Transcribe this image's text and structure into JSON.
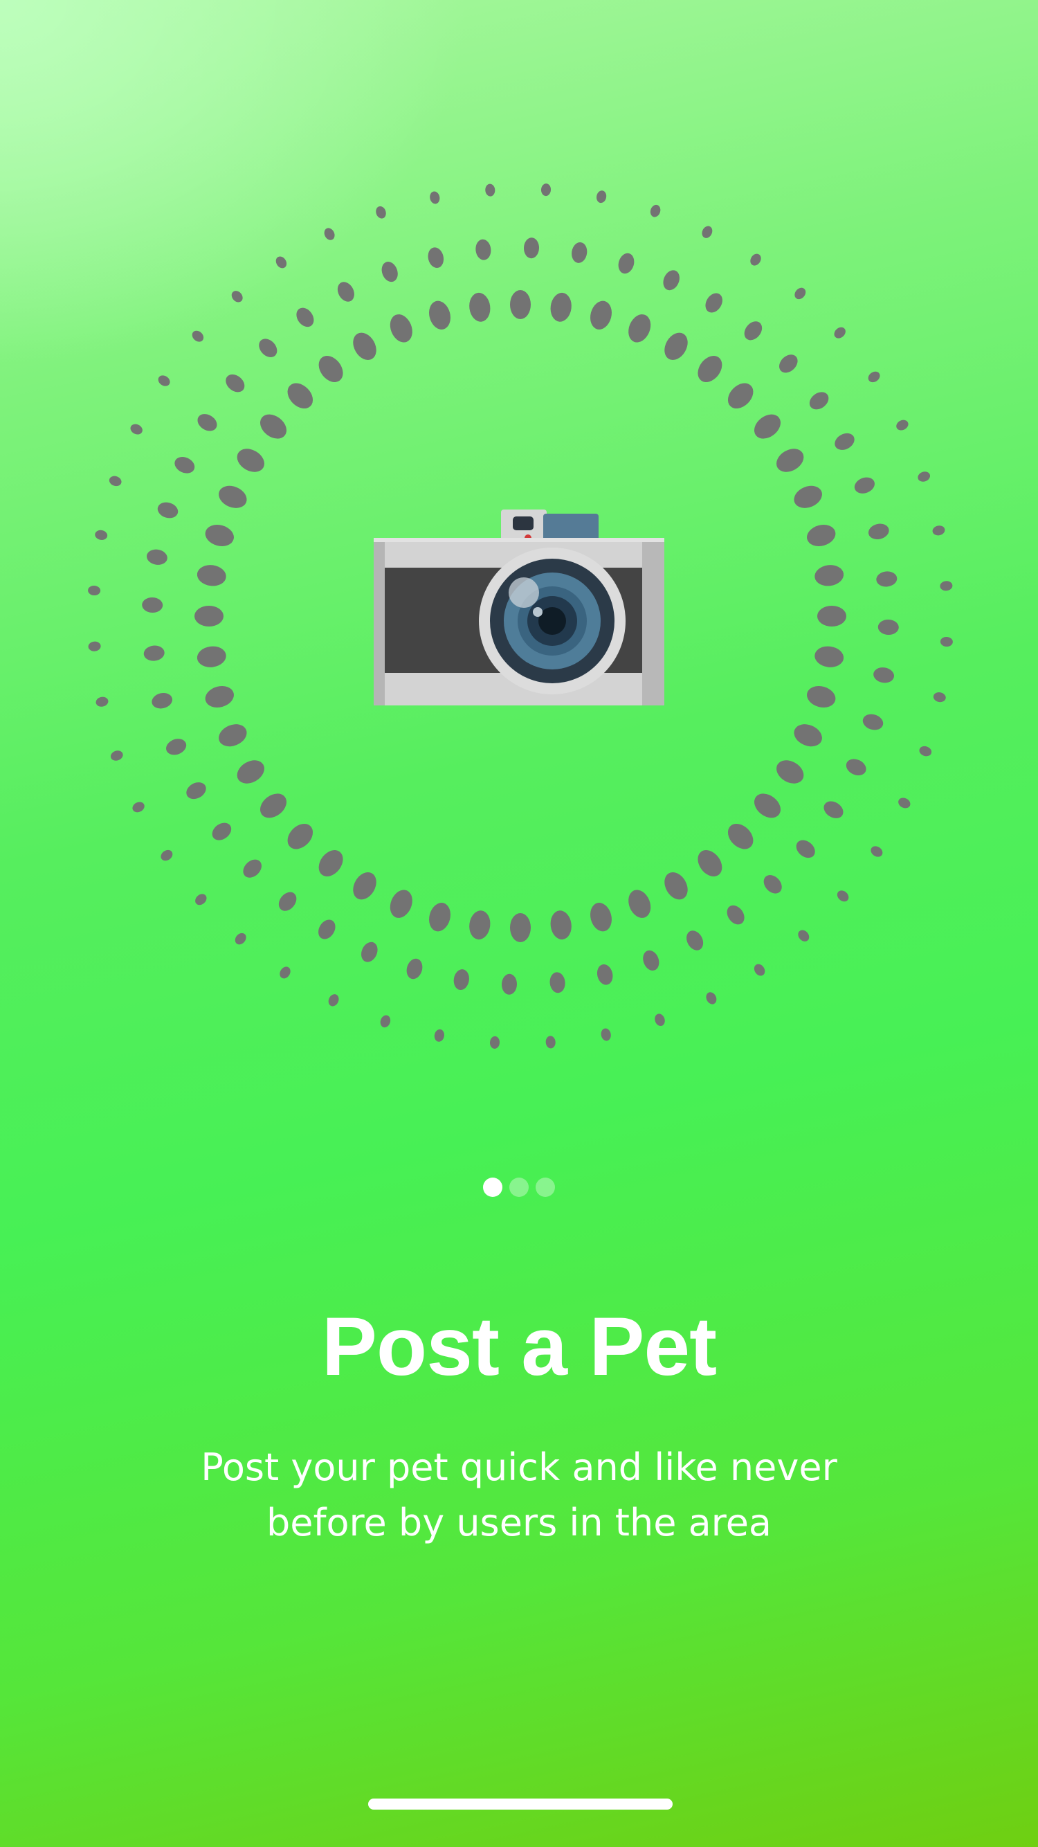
{
  "illustration": {
    "icon": "camera-icon",
    "dot_color": "#737373"
  },
  "pager": {
    "total": 3,
    "current": 1
  },
  "onboarding": {
    "title": "Post a Pet",
    "description": "Post your pet quick and like never before by users in the area"
  },
  "colors": {
    "text": "#ffffff",
    "background_top": "#b6fcb0",
    "background_mid": "#47f055",
    "background_bottom": "#6fcf12"
  }
}
